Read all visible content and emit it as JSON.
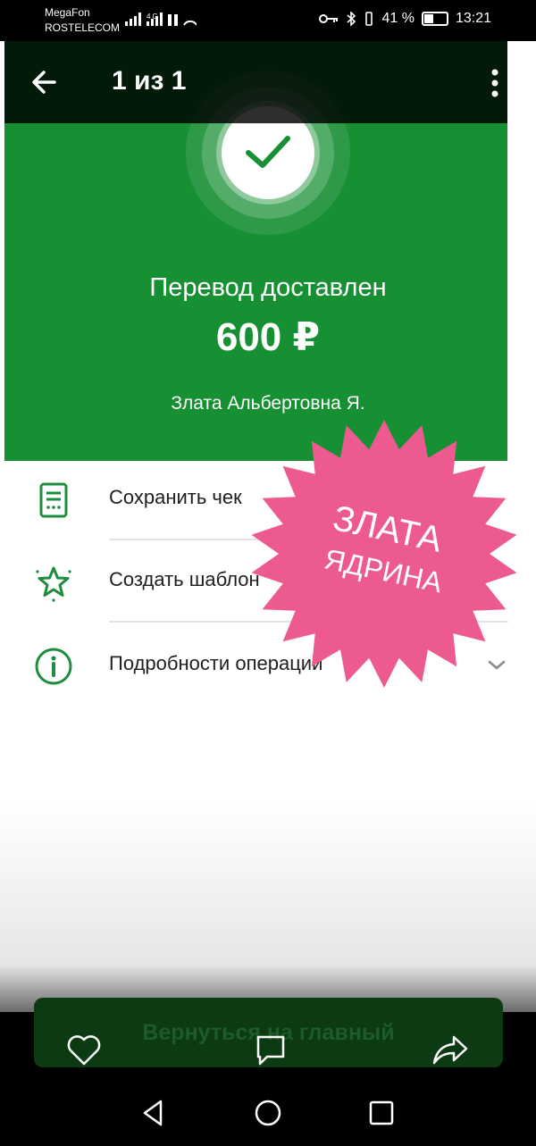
{
  "status_bar": {
    "carrier_1": "MegaFon",
    "carrier_2": "ROSTELECOM",
    "battery_text": "41 %",
    "time": "13:21"
  },
  "toolbar": {
    "pager": "1 из 1"
  },
  "receipt": {
    "status_title": "Перевод доставлен",
    "amount": "600 ₽",
    "recipient": "Злата Альбертовна Я."
  },
  "actions": [
    {
      "label": "Сохранить чек",
      "icon": "receipt-icon"
    },
    {
      "label": "Создать шаблон",
      "icon": "star-icon"
    },
    {
      "label": "Подробности операции",
      "icon": "info-icon"
    }
  ],
  "stamp": {
    "line1": "ЗЛАТА",
    "line2": "ЯДРИНА"
  },
  "bottom": {
    "home_button": "Вернуться на главный"
  },
  "colors": {
    "green": "#178f33",
    "stamp_pink": "#ec5a8f",
    "icon_green": "#1e8e3e"
  }
}
